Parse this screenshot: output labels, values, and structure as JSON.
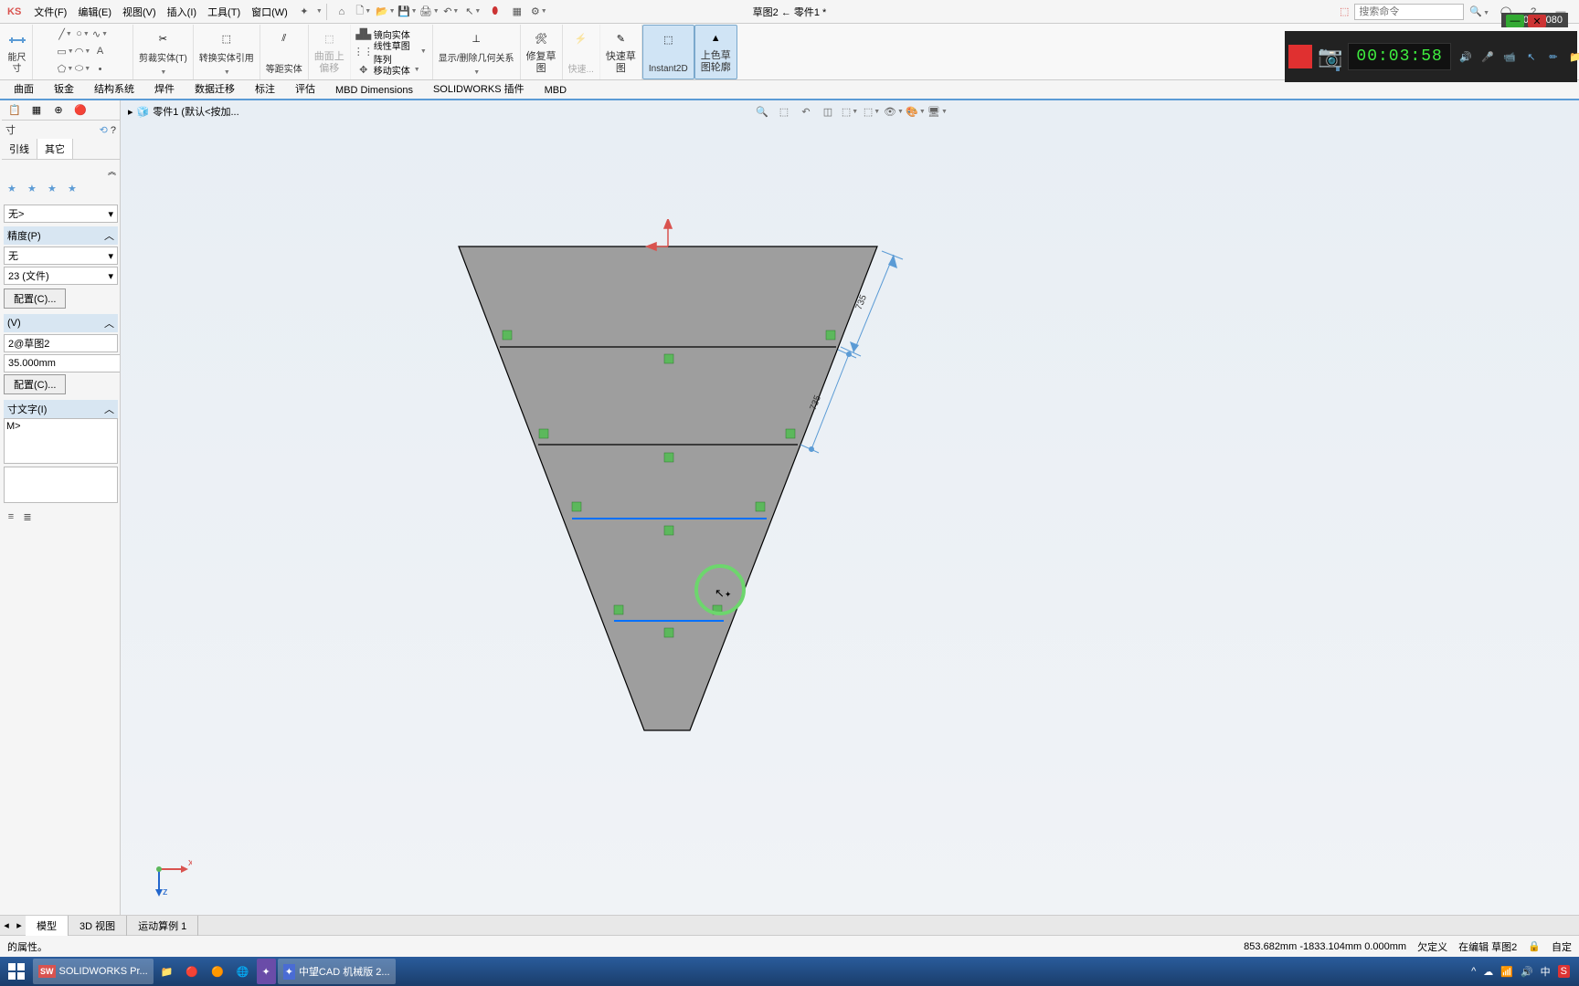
{
  "menubar": {
    "brand": "KS",
    "items": [
      "文件(F)",
      "编辑(E)",
      "视图(V)",
      "插入(I)",
      "工具(T)",
      "窗口(W)"
    ],
    "title": "草图2 ← 零件1 *",
    "search_placeholder": "搜索命令"
  },
  "ribbon": {
    "smart_dim": "能尺寸",
    "trim": "剪裁实体(T)",
    "convert": "转换实体引用",
    "offset": "等距实体",
    "offset2_l1": "曲面上",
    "offset2_l2": "偏移",
    "mirror": "镜向实体",
    "linear": "线性草图阵列",
    "move": "移动实体",
    "relations_l1": "显示/删除几何关系",
    "repair_sketch_l1": "修复草",
    "repair_sketch_l2": "图",
    "quick_l1": "快速...",
    "quick_sketch_l1": "快速草",
    "quick_sketch_l2": "图",
    "instant2d": "Instant2D",
    "shade_l1": "上色草",
    "shade_l2": "图轮廓"
  },
  "tabs": [
    "曲面",
    "钣金",
    "结构系统",
    "焊件",
    "数据迁移",
    "标注",
    "评估",
    "MBD Dimensions",
    "SOLIDWORKS 插件",
    "MBD"
  ],
  "breadcrumb": "零件1  (默认<按加...",
  "panel": {
    "header": "寸",
    "subtabs": [
      "引线",
      "其它"
    ],
    "style_label": "无>",
    "tolerance_label": "精度(P)",
    "tol_value": "无",
    "decimals": "23 (文件)",
    "config_btn": "配置(C)...",
    "main_label": "(V)",
    "link_value": "2@草图2",
    "primary_value": "35.000mm",
    "config_btn2": "配置(C)...",
    "dim_text_label": "寸文字(I)",
    "dim_text_value": "M>"
  },
  "dimensions": {
    "d1": "735",
    "d2": "735"
  },
  "bottom_tabs": [
    "模型",
    "3D 视图",
    "运动算例 1"
  ],
  "status": {
    "hint": "的属性。",
    "coords": "853.682mm   -1833.104mm 0.000mm",
    "mode": "欠定义",
    "editing": "在编辑 草图2",
    "extra": "自定"
  },
  "taskbar": {
    "app1": "SOLIDWORKS Pr...",
    "app2": "中望CAD 机械版 2...",
    "lang": "中",
    "time": ""
  },
  "recorder": {
    "dimensions": "1920 × 1080",
    "timer": "00:03:58"
  }
}
